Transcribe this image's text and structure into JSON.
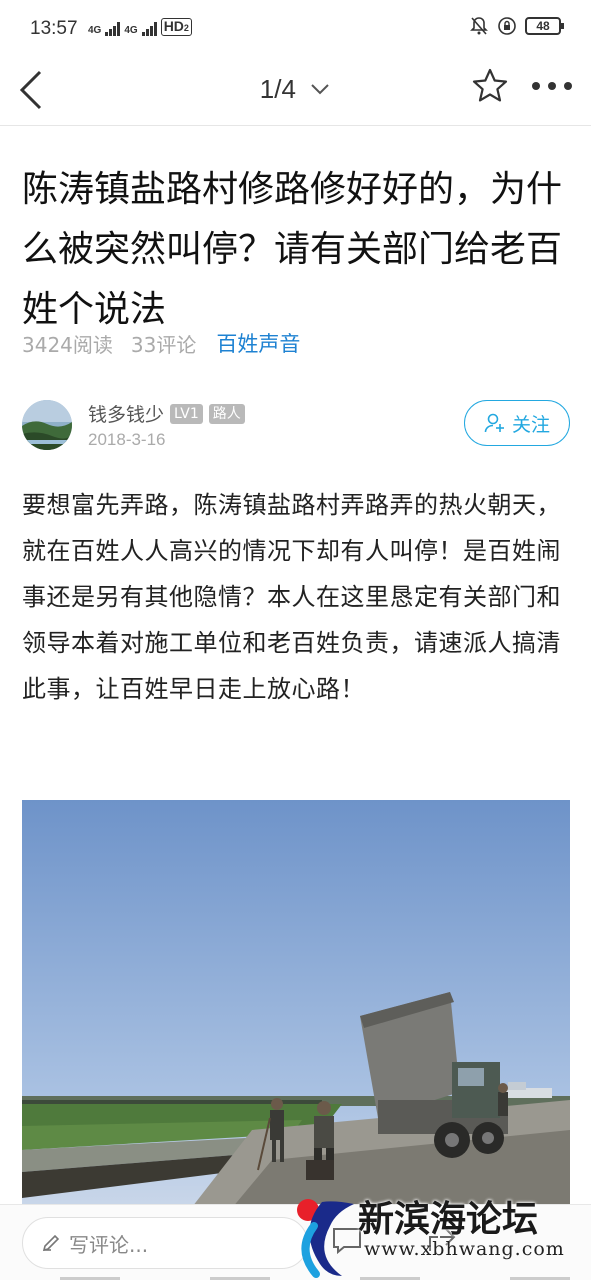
{
  "status_bar": {
    "time": "13:57",
    "network_1": "4G",
    "network_2": "4G",
    "hd_label": "HD",
    "hd_sub": "2",
    "battery": "48"
  },
  "nav": {
    "page_indicator": "1/4"
  },
  "article": {
    "title": "陈涛镇盐路村修路修好好的，为什么被突然叫停？请有关部门给老百姓个说法",
    "read_count": "3424阅读",
    "comment_count": "33评论",
    "forum": "百姓声音",
    "body": "要想富先弄路，陈涛镇盐路村弄路弄的热火朝天，就在百姓人人高兴的情况下却有人叫停！是百姓闹事还是另有其他隐情？本人在这里恳定有关部门和领导本着对施工单位和老百姓负责，请速派人搞清此事，让百姓早日走上放心路！"
  },
  "author": {
    "name": "钱多钱少",
    "level_badge": "LV1",
    "role_badge": "路人",
    "date": "2018-3-16",
    "follow_label": "关注"
  },
  "bottom_bar": {
    "comment_placeholder": "写评论..."
  },
  "watermark": {
    "name": "新滨海论坛",
    "url": "www.xbhwang.com"
  },
  "colors": {
    "accent_blue": "#1e82d2",
    "follow_blue": "#23a8e0",
    "watermark_red": "#e8202a"
  }
}
